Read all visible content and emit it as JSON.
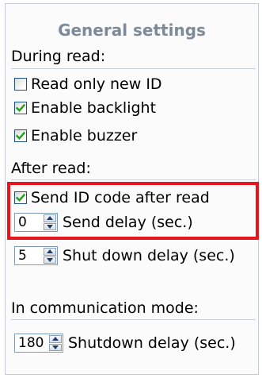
{
  "panel": {
    "title": "General settings"
  },
  "during_read": {
    "label": "During read:",
    "options": [
      {
        "label": "Read only new ID",
        "checked": false
      },
      {
        "label": "Enable backlight",
        "checked": true
      },
      {
        "label": "Enable buzzer",
        "checked": true
      }
    ]
  },
  "after_read": {
    "label": "After read:",
    "send_id": {
      "label": "Send ID code after read",
      "checked": true
    },
    "send_delay": {
      "value": "0",
      "label": "Send delay (sec.)"
    },
    "shutdown_delay": {
      "value": "5",
      "label": "Shut down delay (sec.)"
    }
  },
  "communication_mode": {
    "label": "In communication mode:",
    "shutdown_delay": {
      "value": "180",
      "label": "Shutdown delay (sec.)"
    }
  },
  "colors": {
    "highlight_border": "#e8141b",
    "checkmark": "#21a121",
    "title_text": "#7d8a98"
  }
}
